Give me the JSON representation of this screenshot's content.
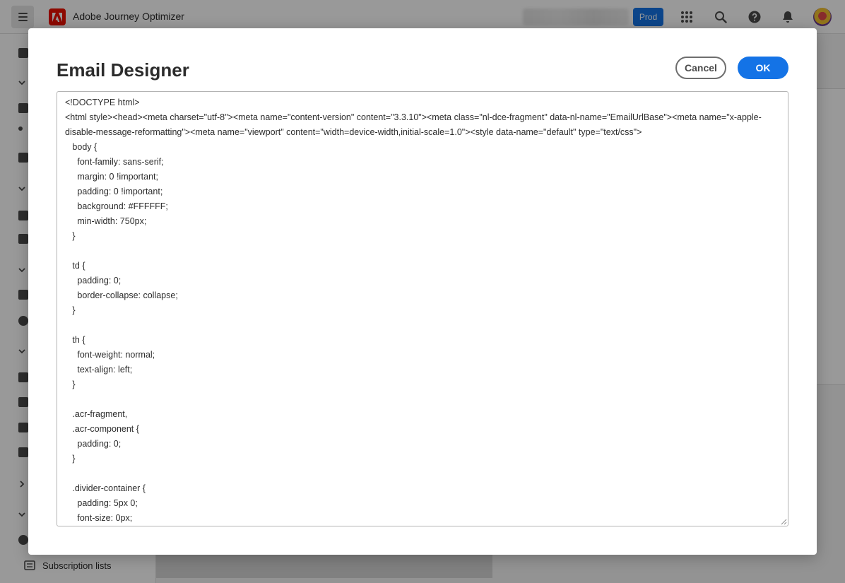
{
  "app": {
    "title": "Adobe Journey Optimizer",
    "environment_badge": "Prod",
    "accent_color": "#1473e6",
    "brand_color": "#eb1000"
  },
  "sidebar": {
    "visible_item_label": "Subscription lists"
  },
  "dialog": {
    "title": "Email Designer",
    "cancel_label": "Cancel",
    "ok_label": "OK",
    "code": "<!DOCTYPE html>\n<html style><head><meta charset=\"utf-8\"><meta name=\"content-version\" content=\"3.3.10\"><meta class=\"nl-dce-fragment\" data-nl-name=\"EmailUrlBase\"><meta name=\"x-apple-disable-message-reformatting\"><meta name=\"viewport\" content=\"width=device-width,initial-scale=1.0\"><style data-name=\"default\" type=\"text/css\">\n   body {\n     font-family: sans-serif;\n     margin: 0 !important;\n     padding: 0 !important;\n     background: #FFFFFF;\n     min-width: 750px;\n   }\n\n   td {\n     padding: 0;\n     border-collapse: collapse;\n   }\n\n   th {\n     font-weight: normal;\n     text-align: left;\n   }\n\n   .acr-fragment,\n   .acr-component {\n     padding: 0;\n   }\n\n   .divider-container {\n     padding: 5px 0;\n     font-size: 0px;"
  }
}
